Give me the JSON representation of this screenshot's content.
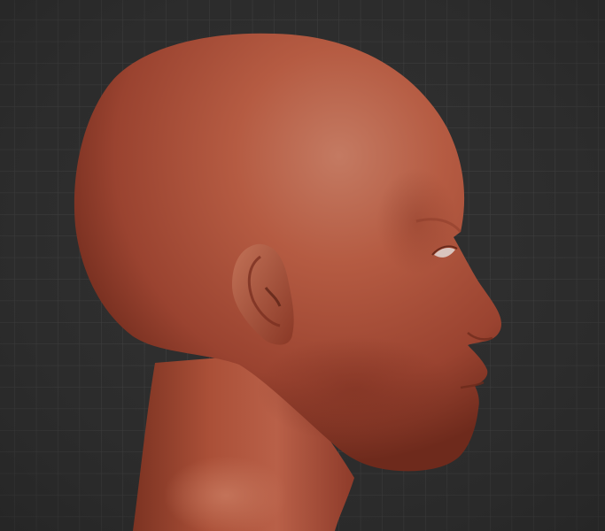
{
  "viewport": {
    "background_color": "#2f2f2f",
    "grid_color": "#4a4a4a",
    "model_color": "#b4573f",
    "model_shadow_color": "#6e2a1c"
  }
}
